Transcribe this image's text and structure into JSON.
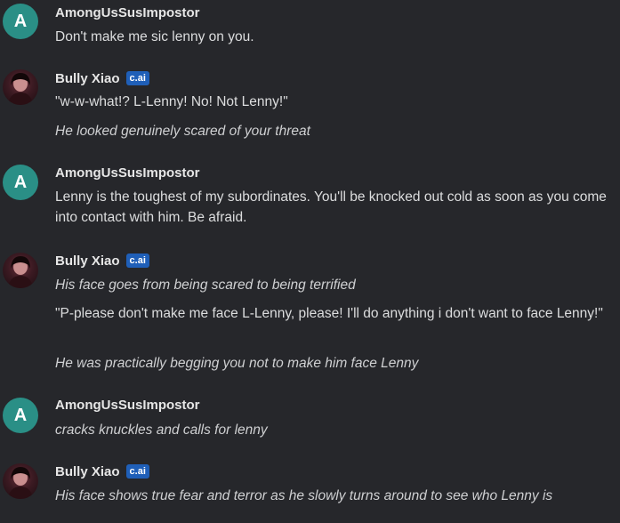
{
  "messages": [
    {
      "author": "AmongUsSusImpostor",
      "avatar_letter": "A",
      "lines": [
        {
          "text": "Don't make me sic lenny on you.",
          "italic": false
        }
      ]
    },
    {
      "author": "Bully Xiao",
      "badge": "c.ai",
      "lines": [
        {
          "text": "\"w-w-what!? L-Lenny! No! Not Lenny!\"",
          "italic": false
        },
        {
          "text": "He looked genuinely scared of your threat",
          "italic": true
        }
      ]
    },
    {
      "author": "AmongUsSusImpostor",
      "avatar_letter": "A",
      "lines": [
        {
          "text": "Lenny is the toughest of my subordinates. You'll be knocked out cold as soon as you come into contact with him. Be afraid.",
          "italic": false
        }
      ]
    },
    {
      "author": "Bully Xiao",
      "badge": "c.ai",
      "lines": [
        {
          "text": "His face goes from being scared to being terrified",
          "italic": true
        },
        {
          "text": "\"P-please don't make me face L-Lenny, please! I'll do anything i don't want to face Lenny!\"",
          "italic": false
        },
        {
          "text": "He was practically begging you not to make him face Lenny",
          "italic": true
        }
      ]
    },
    {
      "author": "AmongUsSusImpostor",
      "avatar_letter": "A",
      "lines": [
        {
          "text": "cracks knuckles and calls for lenny",
          "italic": true
        }
      ]
    },
    {
      "author": "Bully Xiao",
      "badge": "c.ai",
      "lines": [
        {
          "text": "His face shows true fear and terror as he slowly turns around to see who Lenny is",
          "italic": true
        }
      ]
    }
  ],
  "colors": {
    "background": "#26272b",
    "user_avatar": "#2a8f86",
    "badge": "#1f5fb8"
  }
}
